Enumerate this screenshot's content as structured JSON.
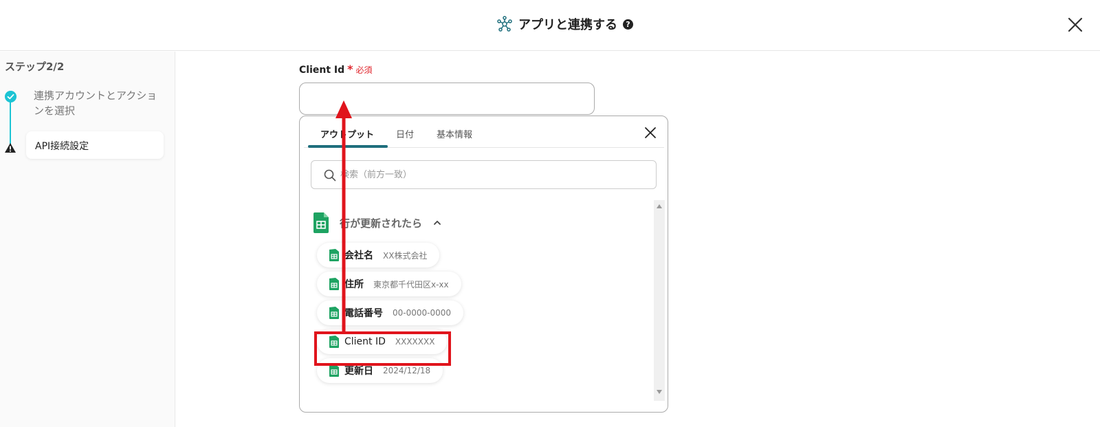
{
  "header": {
    "title": "アプリと連携する",
    "help": "?"
  },
  "sidebar": {
    "step_label": "ステップ2/2",
    "steps": [
      {
        "label": "連携アカウントとアクションを選択",
        "status": "done"
      },
      {
        "label": "API接続設定",
        "status": "warning"
      }
    ]
  },
  "field": {
    "label": "Client Id",
    "required_mark": "*",
    "required_text": "必須",
    "value": ""
  },
  "panel": {
    "tabs": [
      {
        "label": "アウトプット",
        "active": true
      },
      {
        "label": "日付",
        "active": false
      },
      {
        "label": "基本情報",
        "active": false
      }
    ],
    "search": {
      "placeholder": "検索（前方一致）",
      "value": ""
    },
    "group": {
      "title": "行が更新されたら",
      "items": [
        {
          "name": "会社名",
          "value": "XX株式会社"
        },
        {
          "name": "住所",
          "value": "東京都千代田区x-xx"
        },
        {
          "name": "電話番号",
          "value": "00-0000-0000"
        },
        {
          "name": "Client ID",
          "value": "XXXXXXX"
        },
        {
          "name": "更新日",
          "value": "2024/12/18"
        }
      ]
    }
  },
  "colors": {
    "accent": "#1cc4d4",
    "tab_underline": "#1f6f7d",
    "required": "#e0262d",
    "highlight": "#e0141c",
    "sheets_green": "#1ea362"
  }
}
